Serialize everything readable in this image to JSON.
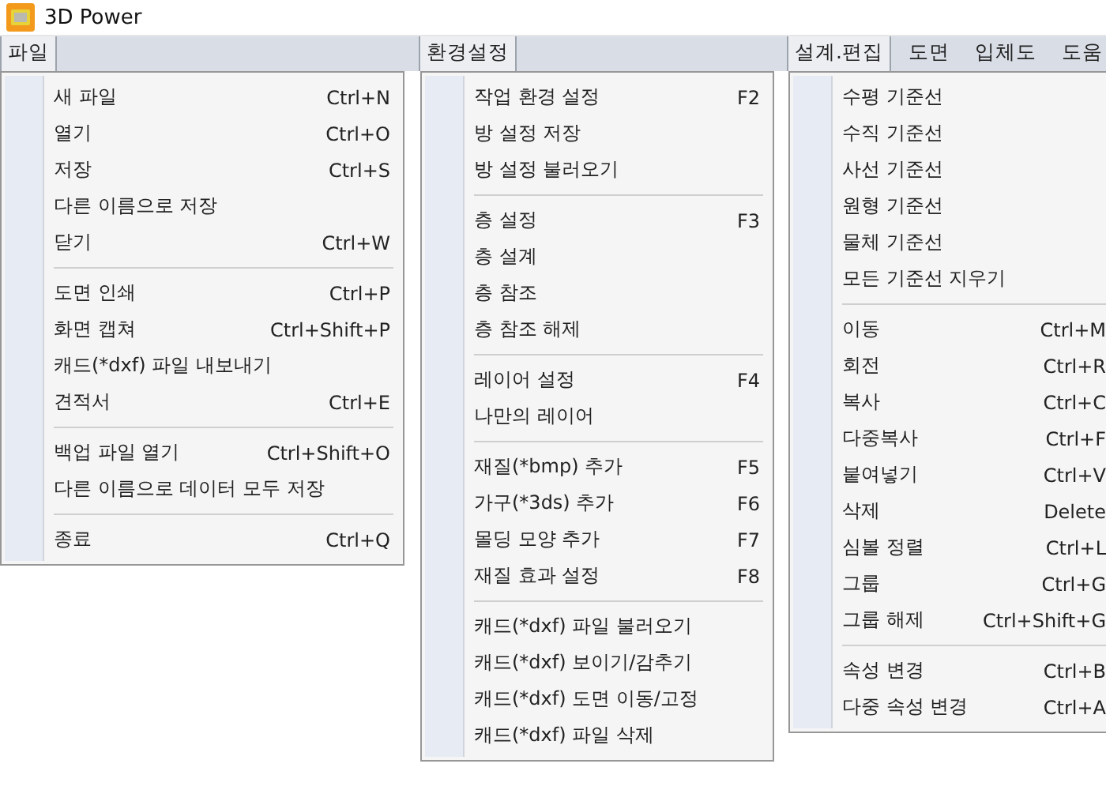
{
  "window": {
    "title": "3D Power"
  },
  "sections": [
    {
      "tabs": [
        {
          "label": "파일",
          "selected": true
        }
      ],
      "groups": [
        [
          {
            "label": "새 파일",
            "shortcut": "Ctrl+N"
          },
          {
            "label": "열기",
            "shortcut": "Ctrl+O"
          },
          {
            "label": "저장",
            "shortcut": "Ctrl+S"
          },
          {
            "label": "다른 이름으로 저장"
          },
          {
            "label": "닫기",
            "shortcut": "Ctrl+W"
          }
        ],
        [
          {
            "label": "도면 인쇄",
            "shortcut": "Ctrl+P"
          },
          {
            "label": "화면 캡쳐",
            "shortcut": "Ctrl+Shift+P"
          },
          {
            "label": "캐드(*dxf) 파일 내보내기"
          },
          {
            "label": "견적서",
            "shortcut": "Ctrl+E"
          }
        ],
        [
          {
            "label": "백업 파일 열기",
            "shortcut": "Ctrl+Shift+O"
          },
          {
            "label": "다른 이름으로 데이터 모두 저장"
          }
        ],
        [
          {
            "label": "종료",
            "shortcut": "Ctrl+Q"
          }
        ]
      ]
    },
    {
      "tabs": [
        {
          "label": "환경설정",
          "selected": true
        }
      ],
      "groups": [
        [
          {
            "label": "작업 환경 설정",
            "shortcut": "F2"
          },
          {
            "label": "방 설정 저장"
          },
          {
            "label": "방 설정 불러오기"
          }
        ],
        [
          {
            "label": "층 설정",
            "shortcut": "F3"
          },
          {
            "label": "층 설계"
          },
          {
            "label": "층 참조"
          },
          {
            "label": "층 참조 해제"
          }
        ],
        [
          {
            "label": "레이어 설정",
            "shortcut": "F4"
          },
          {
            "label": "나만의 레이어"
          }
        ],
        [
          {
            "label": "재질(*bmp) 추가",
            "shortcut": "F5"
          },
          {
            "label": "가구(*3ds) 추가",
            "shortcut": "F6"
          },
          {
            "label": "몰딩 모양 추가",
            "shortcut": "F7"
          },
          {
            "label": "재질 효과 설정",
            "shortcut": "F8"
          }
        ],
        [
          {
            "label": "캐드(*dxf) 파일 불러오기"
          },
          {
            "label": "캐드(*dxf) 보이기/감추기"
          },
          {
            "label": "캐드(*dxf) 도면 이동/고정"
          },
          {
            "label": "캐드(*dxf) 파일 삭제"
          }
        ]
      ]
    },
    {
      "tabs": [
        {
          "label": "설계.편집",
          "selected": true
        },
        {
          "label": "도면",
          "selected": false
        },
        {
          "label": "입체도",
          "selected": false
        },
        {
          "label": "도움",
          "selected": false
        }
      ],
      "groups": [
        [
          {
            "label": "수평 기준선"
          },
          {
            "label": "수직 기준선"
          },
          {
            "label": "사선 기준선"
          },
          {
            "label": "원형 기준선"
          },
          {
            "label": "물체 기준선"
          },
          {
            "label": "모든 기준선 지우기"
          }
        ],
        [
          {
            "label": "이동",
            "shortcut": "Ctrl+M"
          },
          {
            "label": "회전",
            "shortcut": "Ctrl+R"
          },
          {
            "label": "복사",
            "shortcut": "Ctrl+C"
          },
          {
            "label": "다중복사",
            "shortcut": "Ctrl+F"
          },
          {
            "label": "붙여넣기",
            "shortcut": "Ctrl+V"
          },
          {
            "label": "삭제",
            "shortcut": "Delete"
          },
          {
            "label": "심볼 정렬",
            "shortcut": "Ctrl+L"
          },
          {
            "label": "그룹",
            "shortcut": "Ctrl+G"
          },
          {
            "label": "그룹 해제",
            "shortcut": "Ctrl+Shift+G"
          }
        ],
        [
          {
            "label": "속성 변경",
            "shortcut": "Ctrl+B"
          },
          {
            "label": "다중 속성 변경",
            "shortcut": "Ctrl+A"
          }
        ]
      ]
    }
  ]
}
